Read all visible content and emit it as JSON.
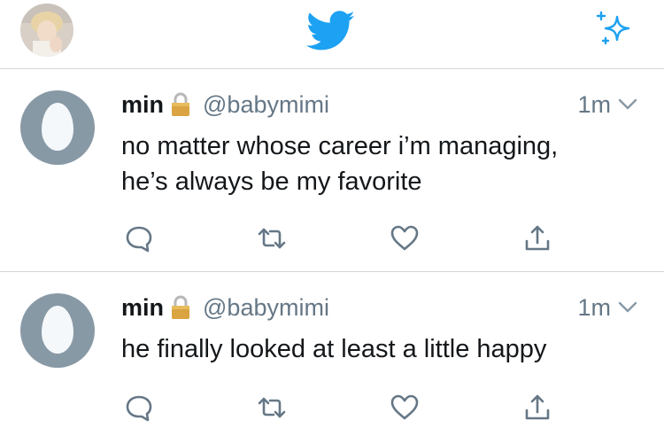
{
  "header": {
    "profile_icon": "profile-avatar",
    "logo_icon": "twitter-bird-icon",
    "sparkle_icon": "sparkle-icon"
  },
  "colors": {
    "brand_blue": "#1da1f2",
    "muted_text": "#657786",
    "egg_gray": "#8899a6",
    "divider": "#d4d7da"
  },
  "tweets": [
    {
      "name": "min",
      "handle": "@babymimi",
      "time": "1m",
      "text_lines": [
        "no matter whose career i’m managing,",
        "he’s always be my favorite"
      ]
    },
    {
      "name": "min",
      "handle": "@babymimi",
      "time": "1m",
      "text_lines": [
        "he finally looked at least a little happy"
      ]
    }
  ],
  "action_icons": [
    "reply-icon",
    "retweet-icon",
    "like-icon",
    "share-icon"
  ]
}
